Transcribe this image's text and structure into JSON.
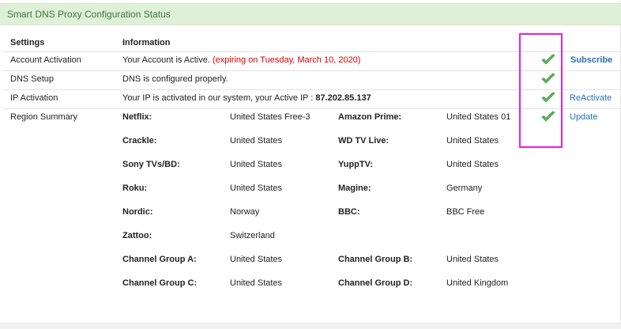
{
  "header": {
    "title": "Smart DNS Proxy Configuration Status"
  },
  "table": {
    "col_settings": "Settings",
    "col_information": "Information",
    "rows": [
      {
        "setting": "Account Activation",
        "info": "Your Account is Active.",
        "info_extra": "(expiring on Tuesday, March 10, 2020)",
        "action": "Subscribe"
      },
      {
        "setting": "DNS Setup",
        "info": "DNS is configured properly."
      },
      {
        "setting": "IP Activation",
        "info": "Your IP is activated in our system, your Active IP : ",
        "info_ip": "87.202.85.137",
        "action": "ReActivate"
      },
      {
        "setting": "Region Summary",
        "action": "Update"
      }
    ]
  },
  "regions": [
    {
      "label": "Netflix:",
      "value": "United States Free-3"
    },
    {
      "label": "Amazon Prime:",
      "value": "United States 01"
    },
    {
      "label": "Crackle:",
      "value": "United States"
    },
    {
      "label": "WD TV Live:",
      "value": "United States"
    },
    {
      "label": "Sony TVs/BD:",
      "value": "United States"
    },
    {
      "label": "YuppTV:",
      "value": "United States"
    },
    {
      "label": "Roku:",
      "value": "United States"
    },
    {
      "label": "Magine:",
      "value": "Germany"
    },
    {
      "label": "Nordic:",
      "value": "Norway"
    },
    {
      "label": "BBC:",
      "value": "BBC Free"
    },
    {
      "label": "Zattoo:",
      "value": "Switzerland"
    },
    {
      "label": "Channel Group A:",
      "value": "United States"
    },
    {
      "label": "Channel Group B:",
      "value": "United States"
    },
    {
      "label": "Channel Group C:",
      "value": "United States"
    },
    {
      "label": "Channel Group D:",
      "value": "United Kingdom"
    }
  ],
  "colors": {
    "header_bg": "#dff0d8",
    "header_text": "#3c763d",
    "check": "#5cb85c",
    "link": "#2a6fb5",
    "warning": "#e00000",
    "highlight": "#e61ee6"
  },
  "icons": {
    "status": "green-checkmark-icon"
  }
}
